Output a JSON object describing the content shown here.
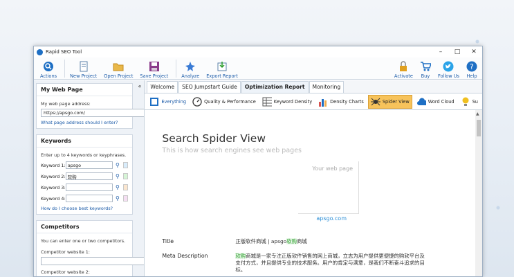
{
  "window": {
    "title": "Rapid SEO Tool"
  },
  "toolbar": {
    "items": [
      {
        "label": "Actions",
        "icon": "actions-icon"
      },
      {
        "label": "New Project",
        "icon": "new-project-icon"
      },
      {
        "label": "Open Project",
        "icon": "folder-icon"
      },
      {
        "label": "Save Project",
        "icon": "save-icon"
      },
      {
        "label": "Analyze",
        "icon": "analyze-icon"
      },
      {
        "label": "Export Report",
        "icon": "export-icon"
      },
      {
        "label": "Activate",
        "icon": "activate-icon"
      },
      {
        "label": "Buy",
        "icon": "cart-icon"
      },
      {
        "label": "Follow Us",
        "icon": "twitter-icon"
      },
      {
        "label": "Help",
        "icon": "help-icon"
      }
    ]
  },
  "mywebpage": {
    "title": "My Web Page",
    "address_label": "My web page address:",
    "address_value": "https://apsgo.com/",
    "link": "What page address should I enter?"
  },
  "keywords": {
    "title": "Keywords",
    "hint": "Enter up to 4 keywords or keyphrases.",
    "rows": [
      {
        "label": "Keyword 1:",
        "value": "apsgo",
        "color": "#d8ecfb"
      },
      {
        "label": "Keyword 2:",
        "value": "软购",
        "color": "#d6f5d6"
      },
      {
        "label": "Keyword 3:",
        "value": "",
        "color": "#fbe6cf"
      },
      {
        "label": "Keyword 4:",
        "value": "",
        "color": "#f5dff3"
      }
    ],
    "link": "How do I choose best keywords?"
  },
  "competitors": {
    "title": "Competitors",
    "hint": "You can enter one or two competitors.",
    "site1_label": "Competitor website 1:",
    "site2_label": "Competitor website 2:"
  },
  "tabs": [
    "Welcome",
    "SEO Jumpstart Guide",
    "Optimization Report",
    "Monitoring"
  ],
  "report_tools": [
    "Everything",
    "Quality & Performance",
    "Keyword Density",
    "Density Charts",
    "Spider View",
    "Word Cloud",
    "Su"
  ],
  "spider": {
    "title": "Search Spider View",
    "subtitle": "This is how search engines see web pages",
    "preview_label": "Your web page",
    "preview_url": "apsgo.com",
    "title_label": "Title",
    "title_value_pre": "正版软件商城 | apsgo",
    "title_value_hl": "软购",
    "title_value_post": "商城",
    "meta_label": "Meta Description",
    "meta_hl": "软购",
    "meta_rest": "商城是一家专注正版软件销售的网上商城，立志为用户提供更便捷的购软平台及支付方式，并且提供专业的技术服务。用户的肯定与满意，是我们不断奋斗追求的目标。"
  }
}
